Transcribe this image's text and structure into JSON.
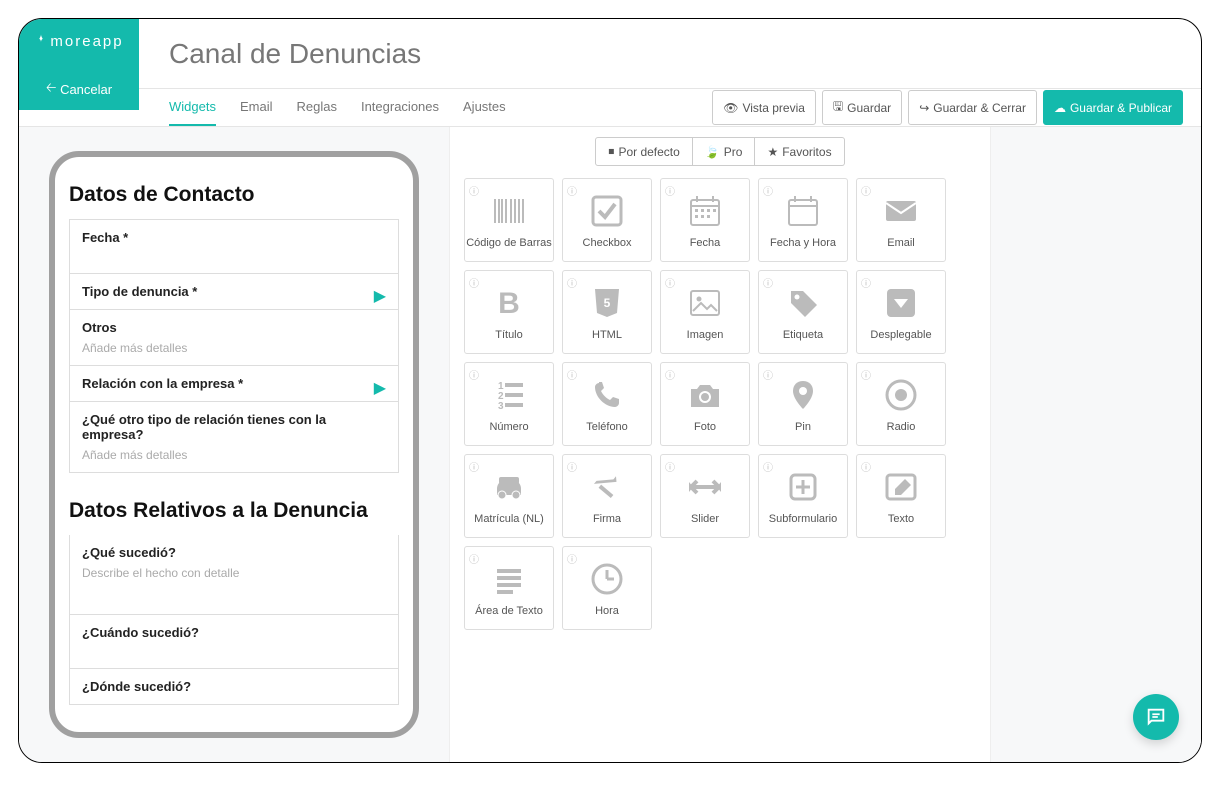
{
  "brand": "moreapp",
  "title": "Canal de Denuncias",
  "cancel": "Cancelar",
  "tabs": [
    "Widgets",
    "Email",
    "Reglas",
    "Integraciones",
    "Ajustes"
  ],
  "active_tab": 0,
  "actions": {
    "preview": "Vista previa",
    "save": "Guardar",
    "save_close": "Guardar & Cerrar",
    "save_publish": "Guardar & Publicar"
  },
  "widget_tabs": {
    "default": "Por defecto",
    "pro": "Pro",
    "favorites": "Favoritos"
  },
  "widgets": [
    {
      "id": "barcode",
      "label": "Código de Barras"
    },
    {
      "id": "checkbox",
      "label": "Checkbox"
    },
    {
      "id": "date",
      "label": "Fecha"
    },
    {
      "id": "datetime",
      "label": "Fecha y Hora"
    },
    {
      "id": "email",
      "label": "Email"
    },
    {
      "id": "title",
      "label": "Título"
    },
    {
      "id": "html",
      "label": "HTML"
    },
    {
      "id": "image",
      "label": "Imagen"
    },
    {
      "id": "tag",
      "label": "Etiqueta"
    },
    {
      "id": "dropdown",
      "label": "Desplegable"
    },
    {
      "id": "number",
      "label": "Número"
    },
    {
      "id": "phone",
      "label": "Teléfono"
    },
    {
      "id": "photo",
      "label": "Foto"
    },
    {
      "id": "pin",
      "label": "Pin"
    },
    {
      "id": "radio",
      "label": "Radio"
    },
    {
      "id": "license",
      "label": "Matrícula (NL)"
    },
    {
      "id": "signature",
      "label": "Firma"
    },
    {
      "id": "slider",
      "label": "Slider"
    },
    {
      "id": "subform",
      "label": "Subformulario"
    },
    {
      "id": "text",
      "label": "Texto"
    },
    {
      "id": "textarea",
      "label": "Área de Texto"
    },
    {
      "id": "time",
      "label": "Hora"
    }
  ],
  "form": {
    "section1": "Datos de Contacto",
    "fields1": [
      {
        "label": "Fecha *",
        "type": "blank"
      },
      {
        "label": "Tipo de denuncia *",
        "type": "select"
      },
      {
        "label": "Otros",
        "sub": "Añade más detalles",
        "type": "text"
      },
      {
        "label": "Relación con la empresa *",
        "type": "select"
      },
      {
        "label": "¿Qué otro tipo de relación tienes con la empresa?",
        "sub": "Añade más detalles",
        "type": "text"
      }
    ],
    "section2": "Datos Relativos a la Denuncia",
    "fields2": [
      {
        "label": "¿Qué sucedió?",
        "sub": "Describe el hecho con detalle",
        "type": "textarea"
      },
      {
        "label": "¿Cuándo sucedió?",
        "type": "blank"
      },
      {
        "label": "¿Dónde sucedió?",
        "type": "blank"
      }
    ]
  }
}
